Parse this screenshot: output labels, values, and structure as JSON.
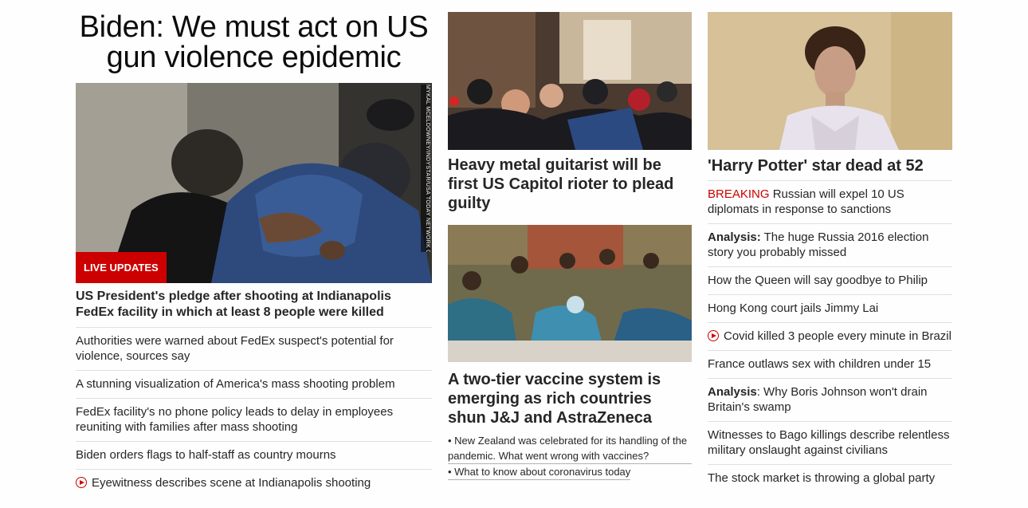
{
  "col1": {
    "headline": "Biden: We must act on US gun violence epidemic",
    "photo_credit": "MYKAL MCELDOWNEY/INDYSTAR/USA TODAY NETWORK CONTENT SERVICES",
    "live_badge": "LIVE UPDATES",
    "lead_link": "US President's pledge after shooting at Indianapolis FedEx facility in which at least 8 people were killed",
    "stories": [
      {
        "text": "Authorities were warned about FedEx suspect's potential for violence, sources say"
      },
      {
        "text": "A stunning visualization of America's mass shooting problem"
      },
      {
        "text": "FedEx facility's no phone policy leads to delay in employees reuniting with families after mass shooting"
      },
      {
        "text": "Biden orders flags to half-staff as country mourns"
      },
      {
        "text": "Eyewitness describes scene at Indianapolis shooting",
        "video": true
      }
    ]
  },
  "col2": {
    "story1": "Heavy metal guitarist will be first US Capitol rioter to plead guilty",
    "story2": "A two-tier vaccine system is emerging as rich countries shun J&J and AstraZeneca",
    "bullets": [
      "• New Zealand was celebrated for its handling of the pandemic. What went wrong with vaccines?",
      "• What to know about coronavirus today"
    ]
  },
  "col3": {
    "headline": "'Harry Potter' star dead at 52",
    "breaking_label": "BREAKING",
    "breaking_text": " Russian will expel 10 US diplomats in response to sanctions",
    "analysis1_kicker": "Analysis:",
    "analysis1_text": " The huge Russia 2016 election story you probably missed",
    "story_queen": "How the Queen will say goodbye to Philip",
    "story_hk": "Hong Kong court jails Jimmy Lai",
    "story_covid": "Covid killed 3 people every minute in Brazil",
    "story_france": "France outlaws sex with children under 15",
    "analysis2_kicker": "Analysis",
    "analysis2_text": ": Why Boris Johnson won't drain Britain's swamp",
    "story_bago": "Witnesses to Bago killings describe relentless military onslaught against civilians",
    "story_market": "The stock market is throwing a global party"
  },
  "colors": {
    "accent_red": "#cc0000",
    "text": "#262626",
    "divider": "#e0e0e0"
  }
}
